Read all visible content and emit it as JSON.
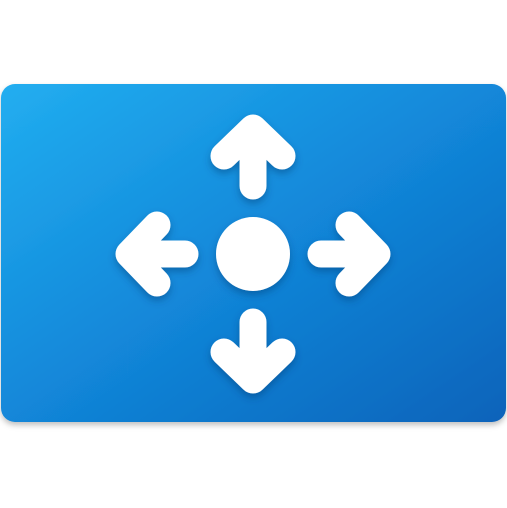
{
  "icon": {
    "name": "move-arrows-app-icon",
    "tile_gradient": [
      "#1faaeb",
      "#0f7fd3",
      "#0a62b8"
    ],
    "glyph_color": "#ffffff",
    "glyphs": [
      "arrow-up-icon",
      "arrow-down-icon",
      "arrow-left-icon",
      "arrow-right-icon",
      "center-dot-icon"
    ]
  }
}
